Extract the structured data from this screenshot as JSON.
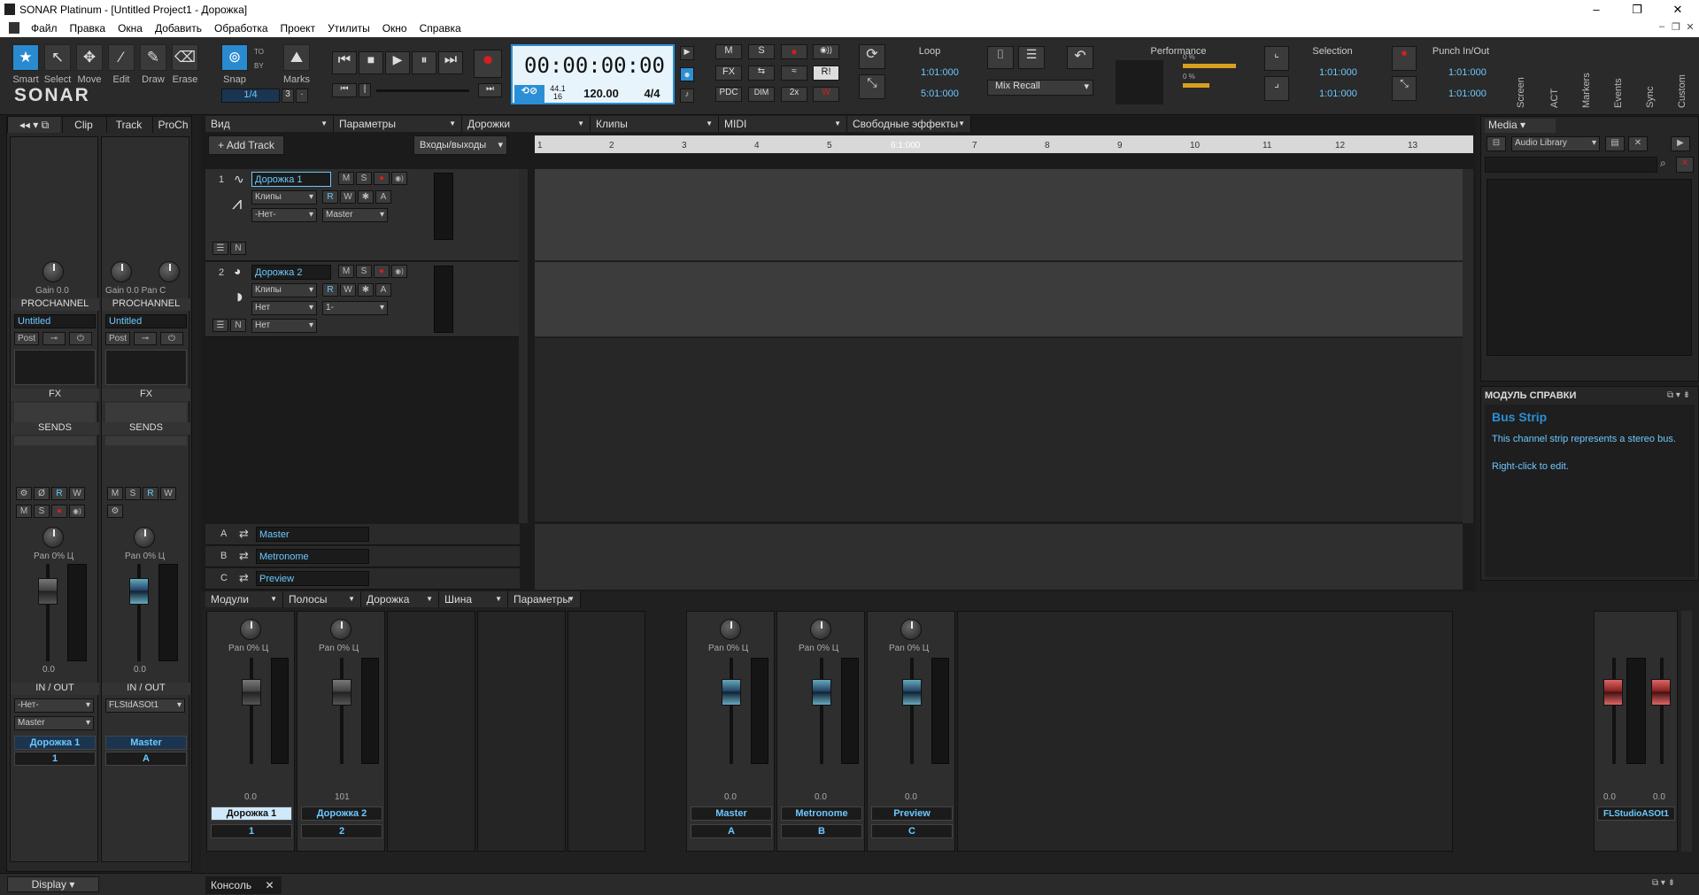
{
  "window": {
    "title": "SONAR Platinum - [Untitled Project1 - Дорожка]",
    "min": "–",
    "max": "❐",
    "close": "✕"
  },
  "menu": [
    "Файл",
    "Правка",
    "Окна",
    "Добавить",
    "Обработка",
    "Проект",
    "Утилиты",
    "Окно",
    "Справка"
  ],
  "tools": [
    {
      "label": "Smart",
      "icon": "★"
    },
    {
      "label": "Select",
      "icon": "↖"
    },
    {
      "label": "Move",
      "icon": "✥"
    },
    {
      "label": "Edit",
      "icon": "⁄"
    },
    {
      "label": "Draw",
      "icon": "✎"
    },
    {
      "label": "Erase",
      "icon": "⌫"
    }
  ],
  "logo": "SONAR",
  "snap": {
    "label": "Snap",
    "value": "1/4",
    "marks": "Marks",
    "by": "BY",
    "to": "TO",
    "small": "3"
  },
  "transport": {
    "time": "00:00:00:00",
    "rate_top": "44.1",
    "rate_bottom": "16",
    "tempo": "120.00",
    "meter": "4/4"
  },
  "mix_buttons": {
    "m": "M",
    "s": "S",
    "fx": "FX",
    "pdc": "PDC",
    "dim": "DIM",
    "x2": "2x",
    "r": "R!"
  },
  "loop": {
    "title": "Loop",
    "start": "1:01:000",
    "end": "5:01:000"
  },
  "mix_recall": "Mix Recall",
  "performance": {
    "title": "Performance",
    "v1": "0 %",
    "v2": "0 %"
  },
  "selection": {
    "title": "Selection",
    "start": "1:01:000",
    "end": "1:01:000"
  },
  "punch": {
    "title": "Punch In/Out",
    "start": "1:01:000",
    "end": "1:01:000"
  },
  "side_modules": [
    "Screen",
    "ACT",
    "Markers",
    "Events",
    "Sync",
    "Custom"
  ],
  "inspector": {
    "tabs": [
      "Clip",
      "Track",
      "ProCh"
    ],
    "strips": [
      {
        "gain": "Gain",
        "gain_val": "0.0",
        "pan": "",
        "prochannel": "PROCHANNEL",
        "preset": "Untitled",
        "post": "Post",
        "fx": "FX",
        "sends": "SENDS",
        "pan2": "Pan",
        "pan2_val": "0% Ц",
        "vol": "0.0",
        "io": "IN / OUT",
        "in": "-Нет-",
        "out": "Master",
        "name": "Дорожка 1",
        "num": "1"
      },
      {
        "gain": "Gain",
        "gain_val": "0.0",
        "pan": "Pan",
        "pan_val": "C",
        "prochannel": "PROCHANNEL",
        "preset": "Untitled",
        "post": "Post",
        "fx": "FX",
        "sends": "SENDS",
        "pan2": "Pan",
        "pan2_val": "0% Ц",
        "vol": "0.0",
        "io": "IN / OUT",
        "in": "FLStdASOt1",
        "out": "",
        "name": "Master",
        "num": "A"
      }
    ],
    "scale": [
      "6",
      "0",
      "-6",
      "-12",
      "-18",
      "-24",
      "-36",
      "-oo"
    ],
    "meter_scale": [
      "-3",
      "-6",
      "-9",
      "-12",
      "-15",
      "-18",
      "-21",
      "-24",
      "-27",
      "-30",
      "-33",
      "-36",
      "-39"
    ],
    "display": "Display"
  },
  "trackview": {
    "menus": [
      "Вид",
      "Параметры",
      "Дорожки",
      "Клипы",
      "MIDI",
      "Свободные эффекты"
    ],
    "add_track": "+ Add Track",
    "io": "Входы/выходы",
    "ruler": [
      "1",
      "2",
      "3",
      "4",
      "5",
      "6:1:000",
      "7",
      "8",
      "9",
      "10",
      "11",
      "12",
      "13"
    ],
    "tracks": [
      {
        "num": "1",
        "name": "Дорожка 1",
        "clips": "Клипы",
        "in": "-Нет-",
        "out": "Master",
        "scale": [
          "-3",
          "-6",
          "-12",
          "-18",
          "dB-",
          "-24",
          "-30",
          "-36",
          "-42",
          "-48"
        ]
      },
      {
        "num": "2",
        "name": "Дорожка 2",
        "clips": "Клипы",
        "in": "Нет",
        "out": "1-",
        "extra": "Нет",
        "scale": [
          "120",
          "96",
          "72",
          "48"
        ]
      }
    ],
    "buses": [
      {
        "letter": "A",
        "name": "Master"
      },
      {
        "letter": "B",
        "name": "Metronome"
      },
      {
        "letter": "C",
        "name": "Preview"
      }
    ],
    "btn": {
      "m": "M",
      "s": "S",
      "r": "R",
      "w": "W",
      "a": "A"
    }
  },
  "console": {
    "menus": [
      "Модули",
      "Полосы",
      "Дорожка",
      "Шина",
      "Параметры"
    ],
    "channels": [
      {
        "name": "Дорожка 1",
        "num": "1",
        "pan": "Pan",
        "pan_val": "0% Ц",
        "vol": "0.0",
        "scale": [
          "6",
          "0",
          "-6",
          "-12",
          "-18",
          "-24",
          "-36",
          "-oo"
        ]
      },
      {
        "name": "Дорожка 2",
        "num": "2",
        "pan": "Pan",
        "pan_val": "0% Ц",
        "vol": "101",
        "scale": [
          "127",
          "112",
          "96",
          "80",
          "64",
          "48",
          "32",
          "16",
          "0"
        ]
      },
      {
        "name": "Master",
        "num": "A",
        "pan": "Pan",
        "pan_val": "0% Ц",
        "vol": "0.0",
        "scale": [
          "6",
          "0",
          "-6",
          "-12",
          "-18",
          "-24",
          "-36",
          "-oo"
        ]
      },
      {
        "name": "Metronome",
        "num": "B",
        "pan": "Pan",
        "pan_val": "0% Ц",
        "vol": "0.0",
        "scale": [
          "6",
          "0",
          "-6",
          "-12",
          "-18",
          "-24",
          "-36",
          "-oo"
        ]
      },
      {
        "name": "Preview",
        "num": "C",
        "pan": "Pan",
        "pan_val": "0% Ц",
        "vol": "0.0",
        "scale": [
          "6",
          "0",
          "-6",
          "-12",
          "-18",
          "-24",
          "-36",
          "-oo"
        ]
      }
    ],
    "hw": {
      "name": "FLStudioASOt1",
      "vol_l": "0.0",
      "vol_r": "0.0"
    },
    "tab": "Консоль"
  },
  "browser": {
    "tab": "Media",
    "library": "Audio Library"
  },
  "help": {
    "title": "МОДУЛЬ СПРАВКИ",
    "heading": "Bus Strip",
    "text1": "This channel strip represents a stereo bus.",
    "text2": "Right-click to edit."
  },
  "colors": {
    "accent": "#2b8fd6",
    "text_blue": "#6cc8ff",
    "record": "#d02020"
  }
}
